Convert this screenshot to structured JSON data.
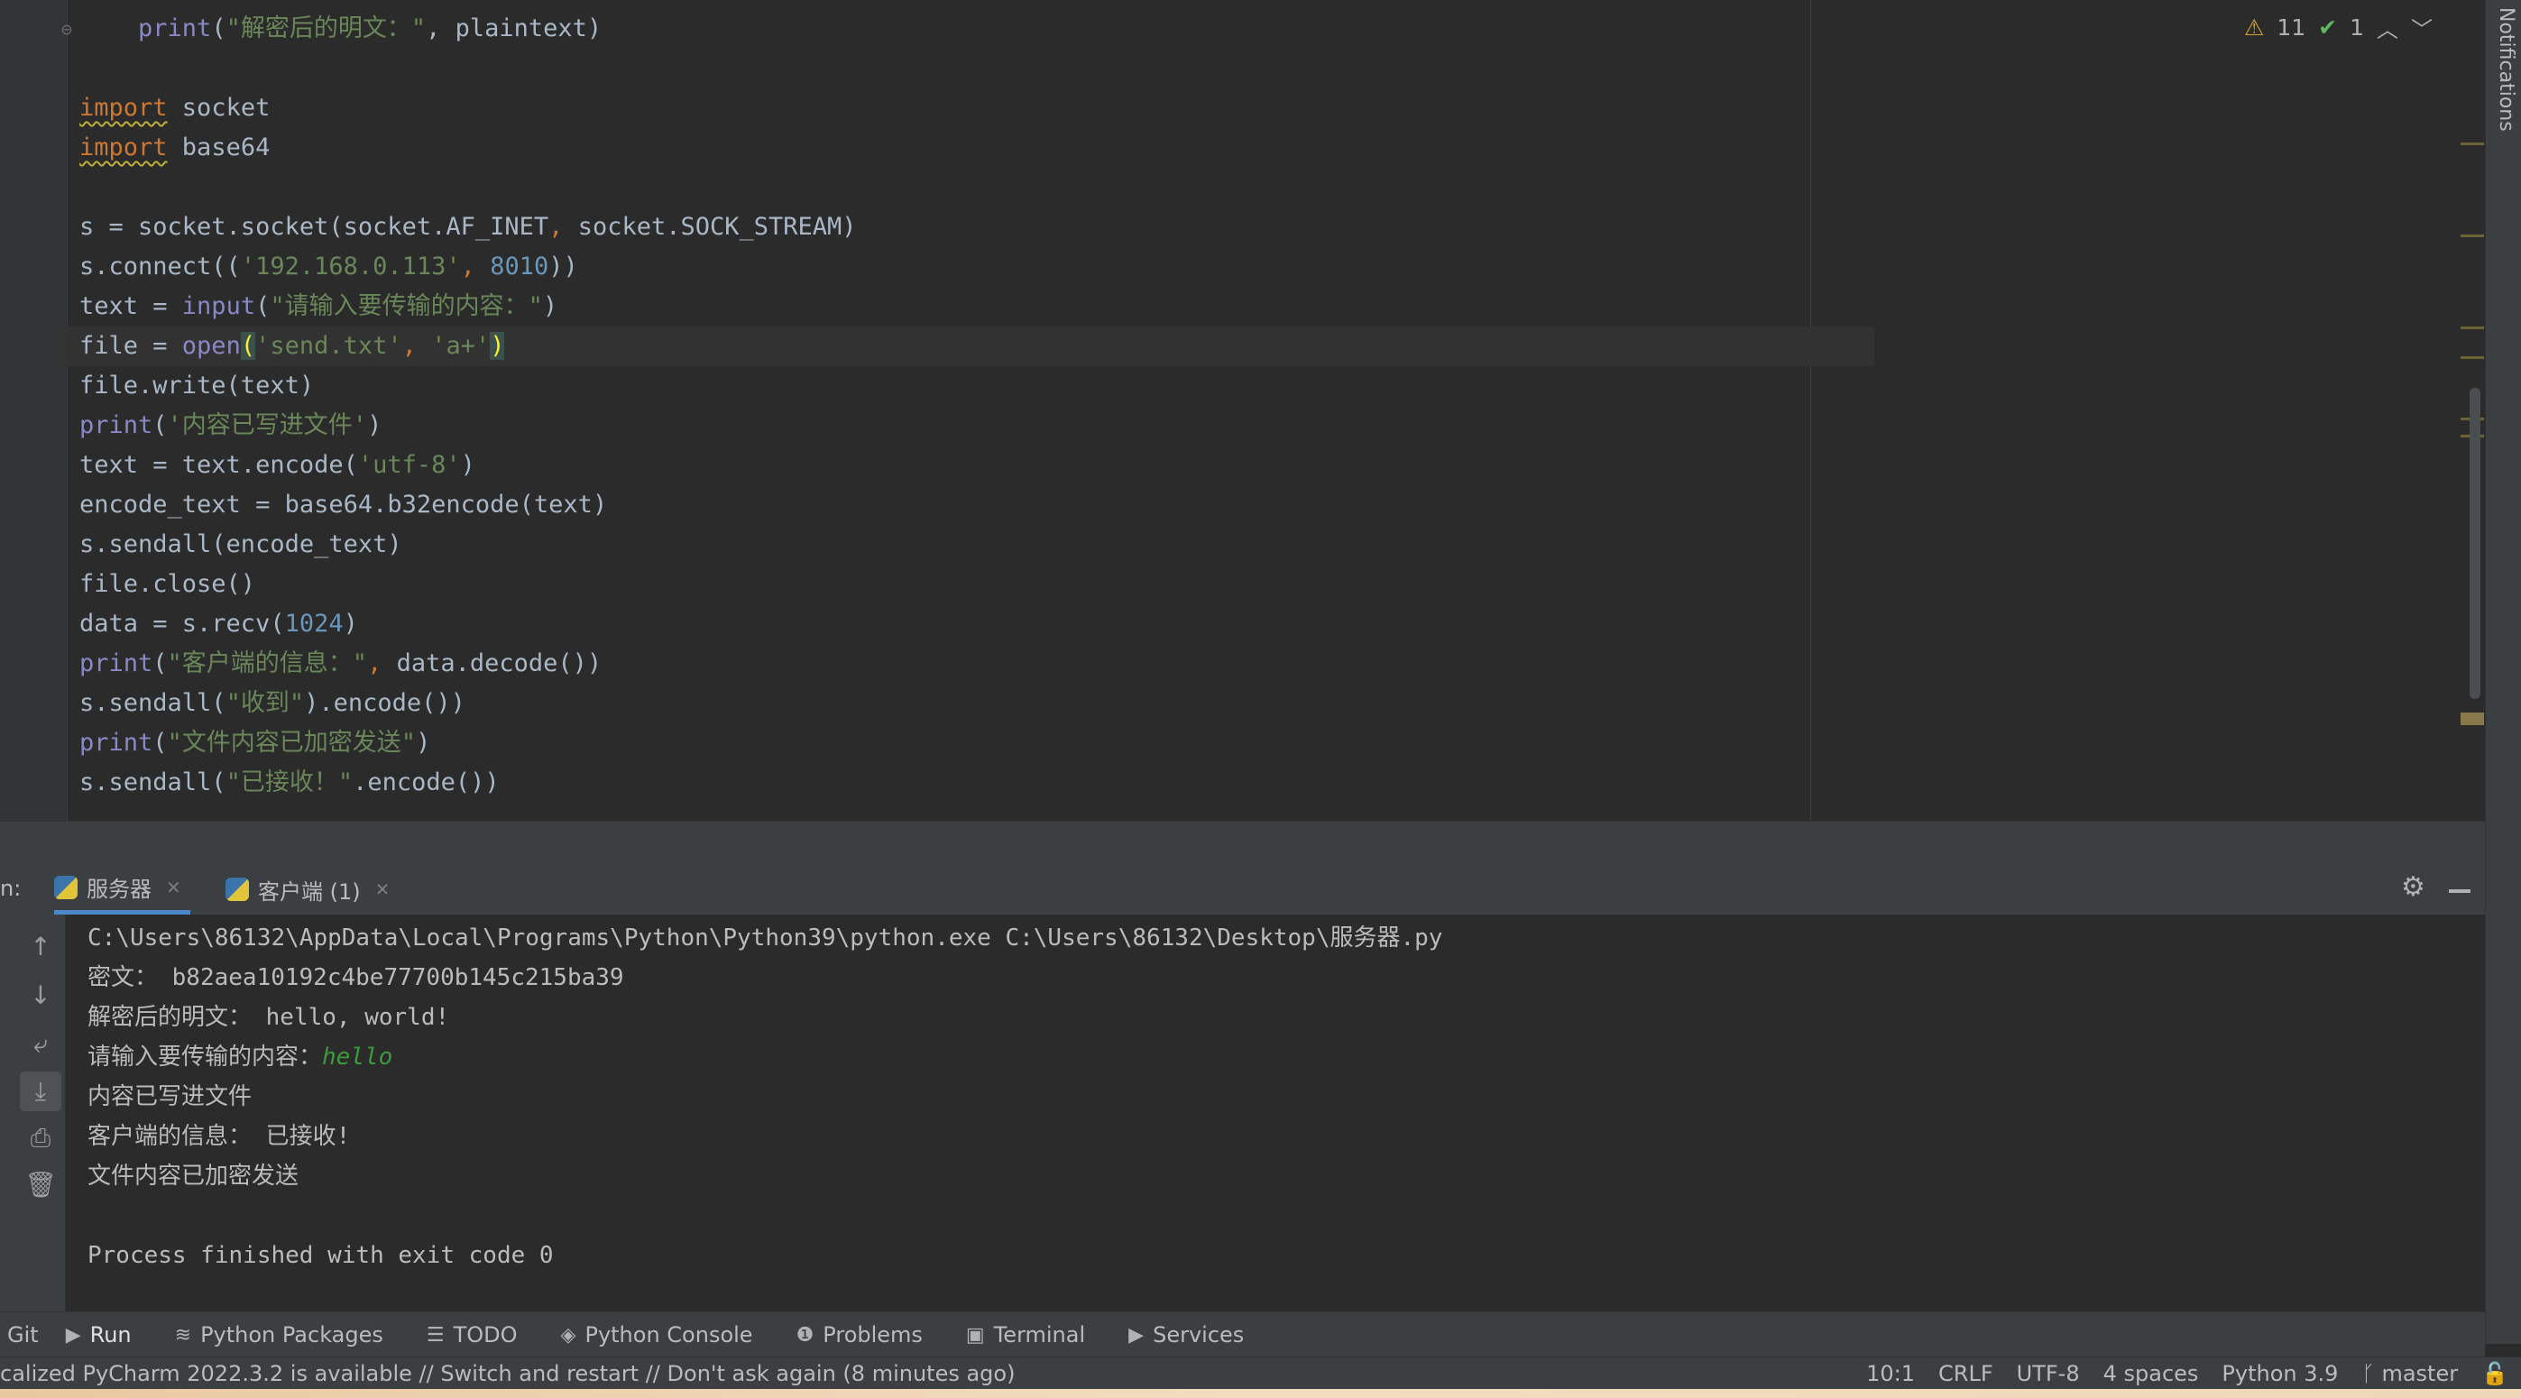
{
  "editor": {
    "lines": [
      {
        "t": "    print(\"解密后的明文：\", plaintext)"
      },
      {
        "t": ""
      },
      {
        "t": "import socket"
      },
      {
        "t": "import base64"
      },
      {
        "t": ""
      },
      {
        "t": "s = socket.socket(socket.AF_INET, socket.SOCK_STREAM)"
      },
      {
        "t": "s.connect(('192.168.0.113', 8010))"
      },
      {
        "t": "text = input(\"请输入要传输的内容：\")"
      },
      {
        "t": "file = open('send.txt', 'a+')"
      },
      {
        "t": "file.write(text)"
      },
      {
        "t": "print('内容已写进文件')"
      },
      {
        "t": "text = text.encode('utf-8')"
      },
      {
        "t": "encode_text = base64.b32encode(text)"
      },
      {
        "t": "s.sendall(encode_text)"
      },
      {
        "t": "file.close()"
      },
      {
        "t": "data = s.recv(1024)"
      },
      {
        "t": "print(\"客户端的信息：\", data.decode())"
      },
      {
        "t": "s.sendall(\"收到\".encode())"
      },
      {
        "t": "print(\"文件内容已加密发送\")"
      },
      {
        "t": "s.sendall(\"已接收！\".encode())"
      }
    ],
    "current_line_index": 8,
    "inspections": {
      "warnings": "11",
      "typos": "1"
    }
  },
  "colors": {
    "keyword": "#cc7832",
    "string": "#6a8759",
    "number": "#6897bb",
    "builtin": "#8888c6",
    "accent": "#4a88c7"
  },
  "notifications_label": "Notifications",
  "run_panel": {
    "prefix": "n:",
    "tabs": [
      {
        "label": "服务器",
        "active": true
      },
      {
        "label": "客户端 (1)",
        "active": false
      }
    ]
  },
  "console": {
    "lines": [
      "C:\\Users\\86132\\AppData\\Local\\Programs\\Python\\Python39\\python.exe C:\\Users\\86132\\Desktop\\服务器.py",
      "密文： b82aea10192c4be77700b145c215ba39",
      "解密后的明文： hello, world!",
      "请输入要传输的内容：",
      "内容已写进文件",
      "客户端的信息： 已接收!",
      "文件内容已加密发送",
      "",
      "Process finished with exit code 0"
    ],
    "user_input": "hello"
  },
  "toolbar": {
    "items": [
      {
        "label": "Git",
        "icon": ""
      },
      {
        "label": "Run",
        "icon": "▶"
      },
      {
        "label": "Python Packages",
        "icon": "≋"
      },
      {
        "label": "TODO",
        "icon": "☰"
      },
      {
        "label": "Python Console",
        "icon": "◈"
      },
      {
        "label": "Problems",
        "icon": "❶"
      },
      {
        "label": "Terminal",
        "icon": "▣"
      },
      {
        "label": "Services",
        "icon": "▶"
      }
    ]
  },
  "status": {
    "message": "calized PyCharm 2022.3.2 is available // Switch and restart // Don't ask again (8 minutes ago)",
    "position": "10:1",
    "line_sep": "CRLF",
    "encoding": "UTF-8",
    "indent": "4 spaces",
    "interpreter": "Python 3.9",
    "branch": "master"
  }
}
